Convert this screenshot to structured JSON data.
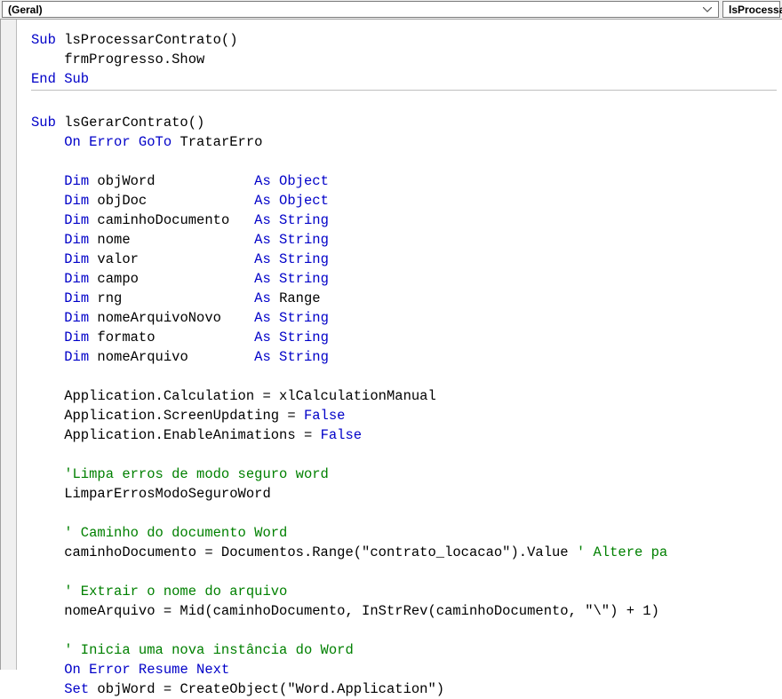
{
  "dropdowns": {
    "left": "(Geral)",
    "right": "lsProcessarC"
  },
  "code": {
    "l1a": "Sub",
    "l1b": " lsProcessarContrato()",
    "l2": "    frmProgresso.Show",
    "l3": "End Sub",
    "l4": "",
    "l5a": "Sub",
    "l5b": " lsGerarContrato()",
    "l6a": "    ",
    "l6b": "On Error GoTo",
    "l6c": " TratarErro",
    "l7": "",
    "l8a": "    ",
    "l8b": "Dim",
    "l8c": " objWord            ",
    "l8d": "As Object",
    "l9a": "    ",
    "l9b": "Dim",
    "l9c": " objDoc             ",
    "l9d": "As Object",
    "l10a": "    ",
    "l10b": "Dim",
    "l10c": " caminhoDocumento   ",
    "l10d": "As String",
    "l11a": "    ",
    "l11b": "Dim",
    "l11c": " nome               ",
    "l11d": "As String",
    "l12a": "    ",
    "l12b": "Dim",
    "l12c": " valor              ",
    "l12d": "As String",
    "l13a": "    ",
    "l13b": "Dim",
    "l13c": " campo              ",
    "l13d": "As String",
    "l14a": "    ",
    "l14b": "Dim",
    "l14c": " rng                ",
    "l14d": "As",
    "l14e": " Range",
    "l15a": "    ",
    "l15b": "Dim",
    "l15c": " nomeArquivoNovo    ",
    "l15d": "As String",
    "l16a": "    ",
    "l16b": "Dim",
    "l16c": " formato            ",
    "l16d": "As String",
    "l17a": "    ",
    "l17b": "Dim",
    "l17c": " nomeArquivo        ",
    "l17d": "As String",
    "l18": "",
    "l19": "    Application.Calculation = xlCalculationManual",
    "l20a": "    Application.ScreenUpdating = ",
    "l20b": "False",
    "l21a": "    Application.EnableAnimations = ",
    "l21b": "False",
    "l22": "",
    "l23": "    'Limpa erros de modo seguro word",
    "l24": "    LimparErrosModoSeguroWord",
    "l25": "",
    "l26": "    ' Caminho do documento Word",
    "l27a": "    caminhoDocumento = Documentos.Range(\"contrato_locacao\").Value ",
    "l27b": "' Altere pa",
    "l28": "",
    "l29": "    ' Extrair o nome do arquivo",
    "l30": "    nomeArquivo = Mid(caminhoDocumento, InStrRev(caminhoDocumento, \"\\\") + 1)",
    "l31": "",
    "l32": "    ' Inicia uma nova instância do Word",
    "l33a": "    ",
    "l33b": "On Error Resume Next",
    "l34a": "    ",
    "l34b": "Set",
    "l34c": " objWord = CreateObject(\"Word.Application\")"
  }
}
